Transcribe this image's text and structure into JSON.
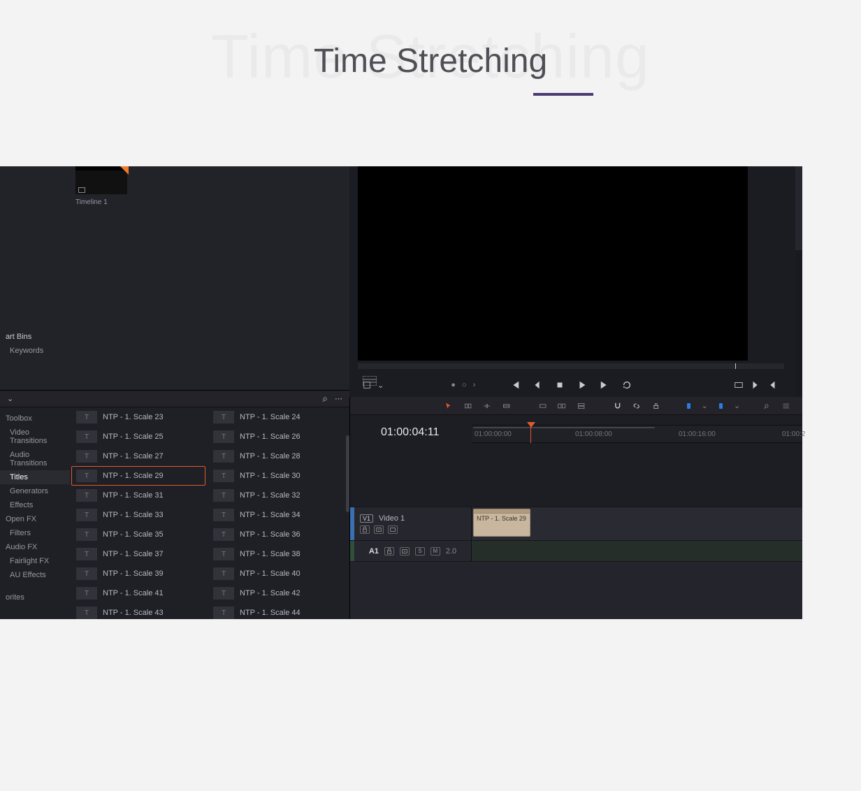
{
  "page": {
    "ghost_title": "Time Stretching",
    "title": "Time Stretching"
  },
  "pool": {
    "timeline_label": "Timeline 1",
    "smart_bins": "art Bins",
    "keywords": "Keywords"
  },
  "transport": {
    "dots": "● ○ ›"
  },
  "fx": {
    "tree": {
      "toolbox": "Toolbox",
      "video_trans": "Video Transitions",
      "audio_trans": "Audio Transitions",
      "titles": "Titles",
      "generators": "Generators",
      "effects": "Effects",
      "openfx": "Open FX",
      "filters": "Filters",
      "audiofx": "Audio FX",
      "fairlight": "Fairlight FX",
      "au": "AU Effects",
      "fav": "orites"
    },
    "items": [
      "NTP - 1. Scale 23",
      "NTP - 1. Scale 24",
      "NTP - 1. Scale 25",
      "NTP - 1. Scale 26",
      "NTP - 1. Scale 27",
      "NTP - 1. Scale 28",
      "NTP - 1. Scale 29",
      "NTP - 1. Scale 30",
      "NTP - 1. Scale 31",
      "NTP - 1. Scale 32",
      "NTP - 1. Scale 33",
      "NTP - 1. Scale 34",
      "NTP - 1. Scale 35",
      "NTP - 1. Scale 36",
      "NTP - 1. Scale 37",
      "NTP - 1. Scale 38",
      "NTP - 1. Scale 39",
      "NTP - 1. Scale 40",
      "NTP - 1. Scale 41",
      "NTP - 1. Scale 42",
      "NTP - 1. Scale 43",
      "NTP - 1. Scale 44"
    ],
    "selected_index": 6,
    "thumb_glyph": "T"
  },
  "timeline": {
    "timecode": "01:00:04:11",
    "ruler": [
      "01:00:00:00",
      "01:00:08:00",
      "01:00:16:00",
      "01:00:2"
    ],
    "video_track": {
      "tag": "V1",
      "name": "Video 1",
      "clip": "NTP - 1. Scale 29"
    },
    "audio_track": {
      "tag": "A1",
      "s": "S",
      "m": "M",
      "val": "2.0"
    }
  },
  "icons": {
    "lock": "🔒",
    "link": "🔗",
    "magnet": "⊃",
    "chevron": "⌄",
    "search": "⌕",
    "dots": "⋯",
    "grip": "⇥"
  }
}
